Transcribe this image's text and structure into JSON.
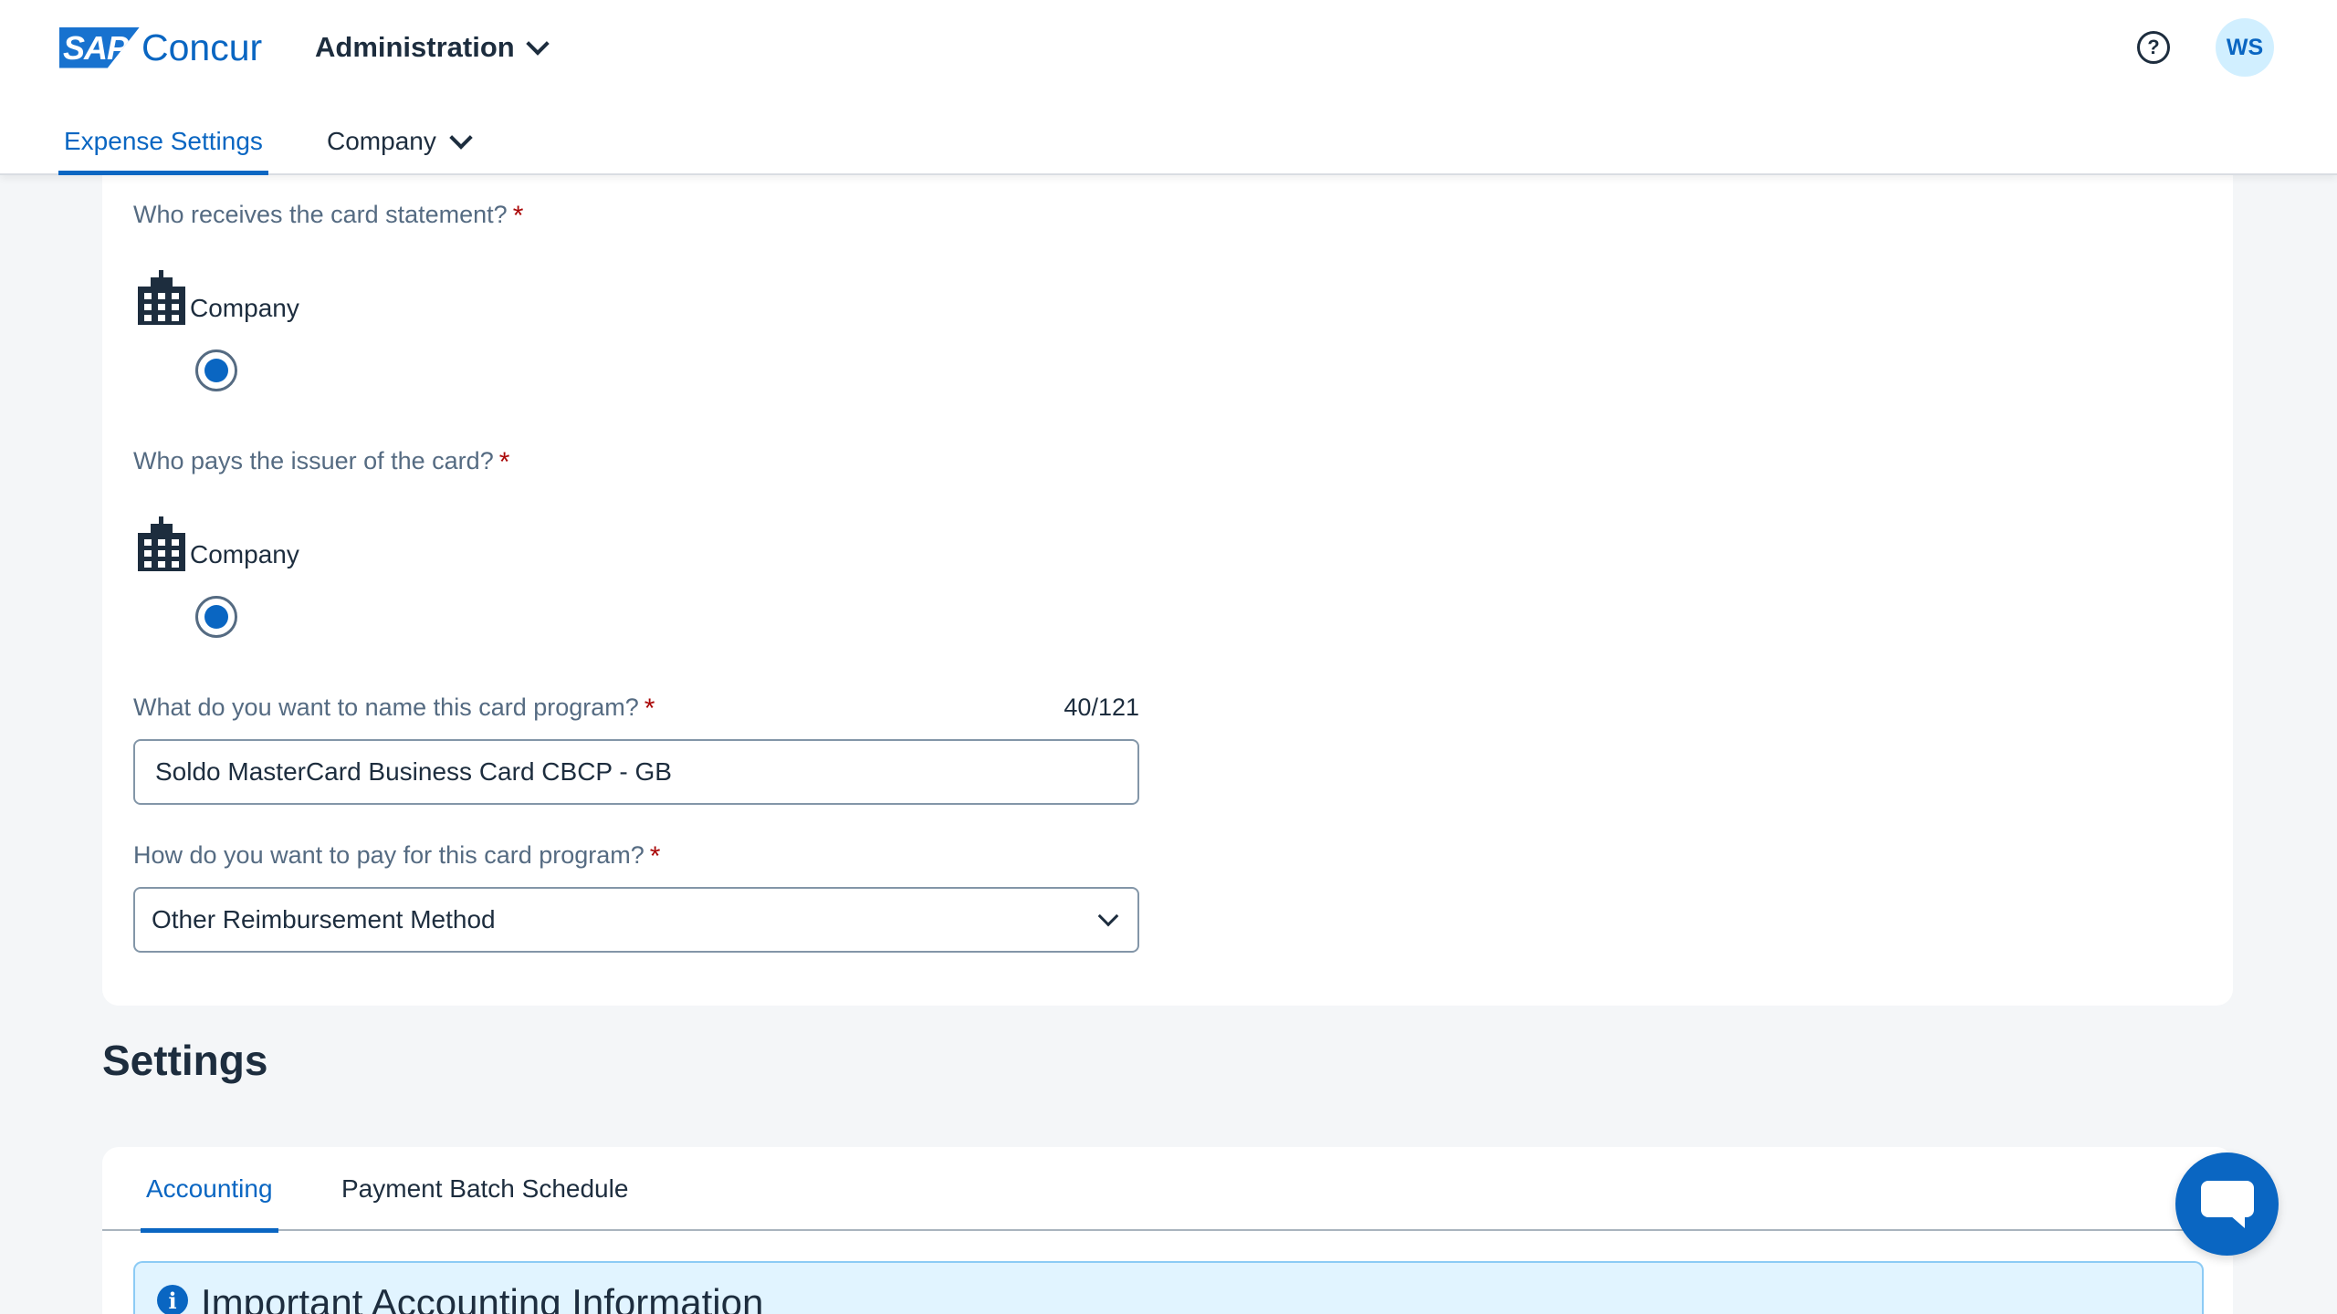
{
  "header": {
    "logo_badge": "SAP",
    "logo_text": "Concur",
    "admin_menu_label": "Administration",
    "help_symbol": "?",
    "avatar_initials": "WS"
  },
  "nav": {
    "tabs": [
      {
        "label": "Expense Settings",
        "active": true
      },
      {
        "label": "Company",
        "active": false,
        "has_dropdown": true
      }
    ]
  },
  "form": {
    "statement_question": "Who receives the card statement?",
    "statement_option": "Company",
    "statement_selected": true,
    "issuer_question": "Who pays the issuer of the card?",
    "issuer_option": "Company",
    "issuer_selected": true,
    "name_question": "What do you want to name this card program?",
    "name_counter": "40/121",
    "name_value": "Soldo MasterCard Business Card CBCP - GB",
    "pay_question": "How do you want to pay for this card program?",
    "pay_value": "Other Reimbursement Method",
    "required_marker": "*"
  },
  "settings": {
    "title": "Settings",
    "tabs": [
      {
        "label": "Accounting",
        "active": true
      },
      {
        "label": "Payment Batch Schedule",
        "active": false
      }
    ],
    "info_symbol": "i",
    "info_title": "Important Accounting Information"
  },
  "colors": {
    "accent": "#0a66c2",
    "required": "#aa0808",
    "background": "#f4f6f8",
    "info_background": "#e1f4ff"
  },
  "icons": {
    "building": "building-icon",
    "help": "help-icon",
    "chat": "chat-icon",
    "info": "info-icon"
  }
}
